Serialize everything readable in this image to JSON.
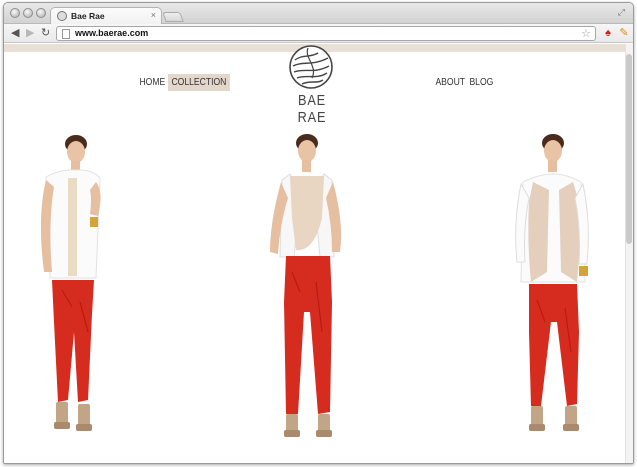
{
  "browser": {
    "tab_title": "Bae Rae",
    "tab_close": "×",
    "url": "www.baerae.com"
  },
  "nav": {
    "home": "HOME",
    "collection": "COLLECTION",
    "about": "ABOUT",
    "blog": "BLOG"
  },
  "brand": {
    "name": "BAE RAE"
  },
  "colors": {
    "accent_beige": "#e8dfd6",
    "nav_active_bg": "#e3d6ca",
    "pants_red": "#d62c1f"
  },
  "icons": [
    "back-icon",
    "forward-icon",
    "reload-icon",
    "star-icon",
    "extension-icon",
    "resize-icon",
    "logo-icon"
  ]
}
